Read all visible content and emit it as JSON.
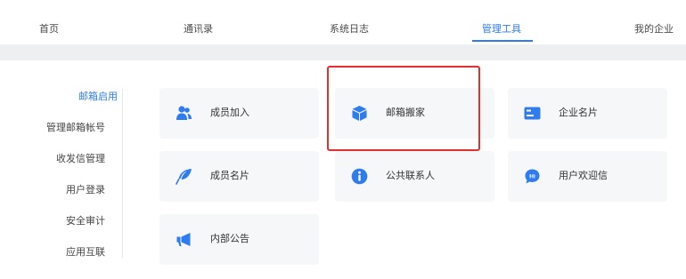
{
  "nav": {
    "items": [
      {
        "label": "首页"
      },
      {
        "label": "通讯录"
      },
      {
        "label": "系统日志"
      },
      {
        "label": "管理工具"
      },
      {
        "label": "我的企业"
      }
    ],
    "active_index": 3
  },
  "sidebar": {
    "items": [
      {
        "label": "邮箱启用"
      },
      {
        "label": "管理邮箱帐号"
      },
      {
        "label": "收发信管理"
      },
      {
        "label": "用户登录"
      },
      {
        "label": "安全审计"
      },
      {
        "label": "应用互联"
      }
    ],
    "active_index": 0
  },
  "cards": [
    {
      "label": "成员加入",
      "icon": "users-icon"
    },
    {
      "label": "邮箱搬家",
      "icon": "box-icon"
    },
    {
      "label": "企业名片",
      "icon": "id-card-icon"
    },
    {
      "label": "成员名片",
      "icon": "feather-icon"
    },
    {
      "label": "公共联系人",
      "icon": "info-icon"
    },
    {
      "label": "用户欢迎信",
      "icon": "chat-hi-icon"
    },
    {
      "label": "内部公告",
      "icon": "megaphone-icon"
    }
  ],
  "colors": {
    "accent": "#2f7bf0",
    "highlight": "#e53030"
  }
}
